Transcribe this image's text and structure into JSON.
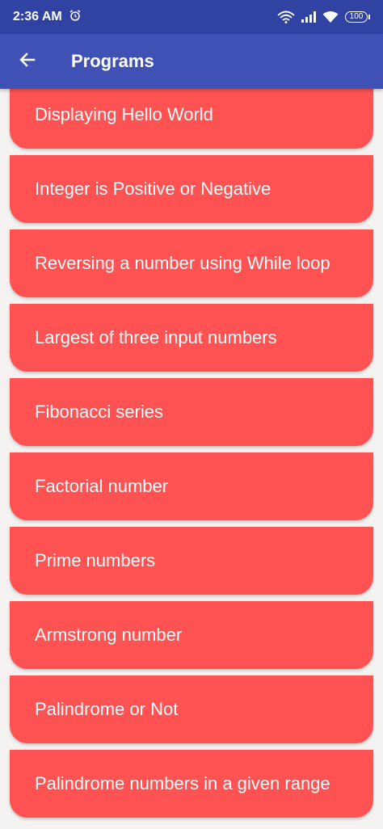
{
  "status_bar": {
    "time": "2:36 AM",
    "battery": "100",
    "icons": [
      "alarm-icon",
      "wifi-hotspot-icon",
      "cell-signal-icon",
      "wifi-icon",
      "battery-icon"
    ]
  },
  "app_bar": {
    "title": "Programs",
    "back_icon": "arrow-left-icon"
  },
  "programs": [
    {
      "label": "Displaying Hello World"
    },
    {
      "label": "Integer is Positive or Negative"
    },
    {
      "label": "Reversing a number using While loop"
    },
    {
      "label": "Largest of three input numbers"
    },
    {
      "label": "Fibonacci series"
    },
    {
      "label": "Factorial number"
    },
    {
      "label": "Prime numbers"
    },
    {
      "label": "Armstrong number"
    },
    {
      "label": "Palindrome or Not"
    },
    {
      "label": "Palindrome numbers in a given range"
    }
  ],
  "colors": {
    "status_bar": "#3043a3",
    "app_bar": "#3f51b5",
    "card": "#ff5252",
    "background": "#f4f1f1"
  }
}
